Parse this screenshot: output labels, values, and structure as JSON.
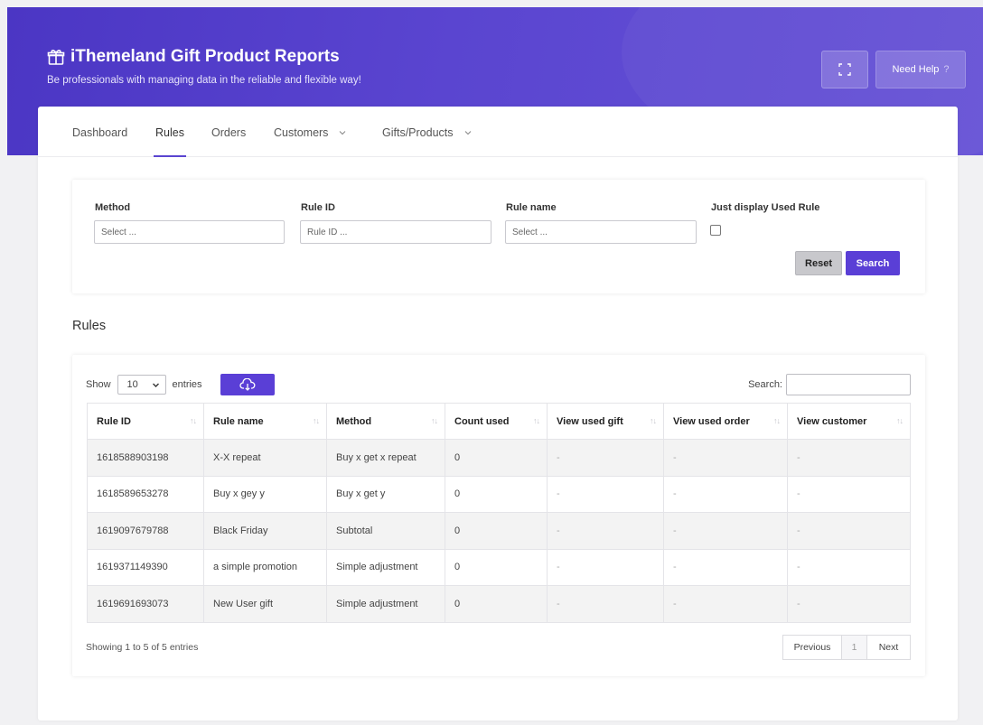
{
  "header": {
    "title": "iThemeland Gift Product Reports",
    "subtitle": "Be professionals with managing data in the reliable and flexible way!",
    "help_label": "Need Help",
    "help_mark": "?"
  },
  "nav": {
    "items": [
      "Dashboard",
      "Rules",
      "Orders",
      "Customers",
      "Gifts/Products"
    ],
    "active": "Rules"
  },
  "filters": {
    "method_label": "Method",
    "method_placeholder": "Select ...",
    "rule_id_label": "Rule ID",
    "rule_id_placeholder": "Rule ID ...",
    "rule_name_label": "Rule name",
    "rule_name_placeholder": "Select ...",
    "used_rule_label": "Just display Used Rule",
    "reset_label": "Reset",
    "search_label": "Search"
  },
  "rules": {
    "section_title": "Rules",
    "show_label": "Show",
    "entries_value": "10",
    "entries_label": "entries",
    "search_label": "Search:",
    "columns": [
      "Rule ID",
      "Rule name",
      "Method",
      "Count used",
      "View used gift",
      "View used order",
      "View customer"
    ],
    "rows": [
      [
        "1618588903198",
        "X-X repeat",
        "Buy x get x repeat",
        "0",
        "-",
        "-",
        "-"
      ],
      [
        "1618589653278",
        "Buy x gey y",
        "Buy x get y",
        "0",
        "-",
        "-",
        "-"
      ],
      [
        "1619097679788",
        "Black Friday",
        "Subtotal",
        "0",
        "-",
        "-",
        "-"
      ],
      [
        "1619371149390",
        "a simple promotion",
        "Simple adjustment",
        "0",
        "-",
        "-",
        "-"
      ],
      [
        "1619691693073",
        "New User gift",
        "Simple adjustment",
        "0",
        "-",
        "-",
        "-"
      ]
    ],
    "info": "Showing 1 to 5 of 5 entries",
    "prev_label": "Previous",
    "page": "1",
    "next_label": "Next"
  }
}
